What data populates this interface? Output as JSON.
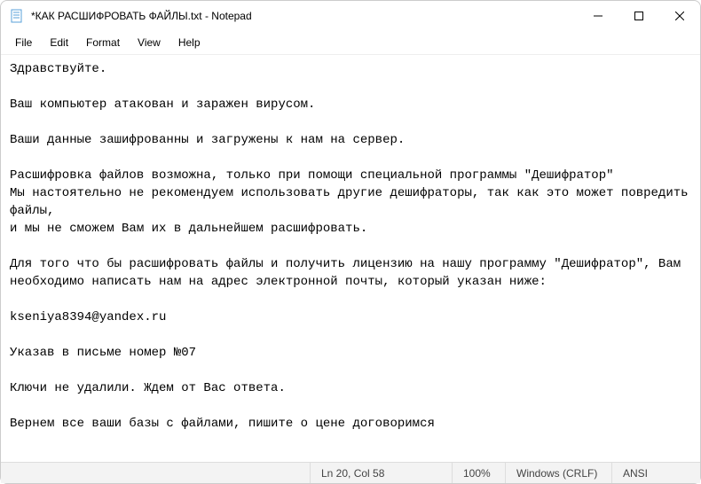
{
  "window": {
    "title": "*КАК РАСШИФРОВАТЬ ФАЙЛЫ.txt - Notepad"
  },
  "menu": {
    "file": "File",
    "edit": "Edit",
    "format": "Format",
    "view": "View",
    "help": "Help"
  },
  "document": {
    "text": "Здравствуйте.\n\nВаш компьютер атакован и заражен вирусом.\n\nВаши данные зашифрованны и загружены к нам на сервер.\n\nРасшифровка файлов возможна, только при помощи специальной программы \"Дешифратор\"\nМы настоятельно не рекомендуем использовать другие дешифраторы, так как это может повредить файлы,\nи мы не сможем Вам их в дальнейшем расшифровать.\n\nДля того что бы расшифровать файлы и получить лицензию на нашу программу \"Дешифратор\", Вам необходимо написать нам на адрес электронной почты, который указан ниже:\n\nkseniya8394@yandex.ru\n\nУказав в письме номер №07\n\nКлючи не удалили. Ждем от Вас ответа.\n\nВернем все ваши базы с файлами, пишите о цене договоримся"
  },
  "status": {
    "position": "Ln 20, Col 58",
    "zoom": "100%",
    "lineending": "Windows (CRLF)",
    "encoding": "ANSI"
  }
}
